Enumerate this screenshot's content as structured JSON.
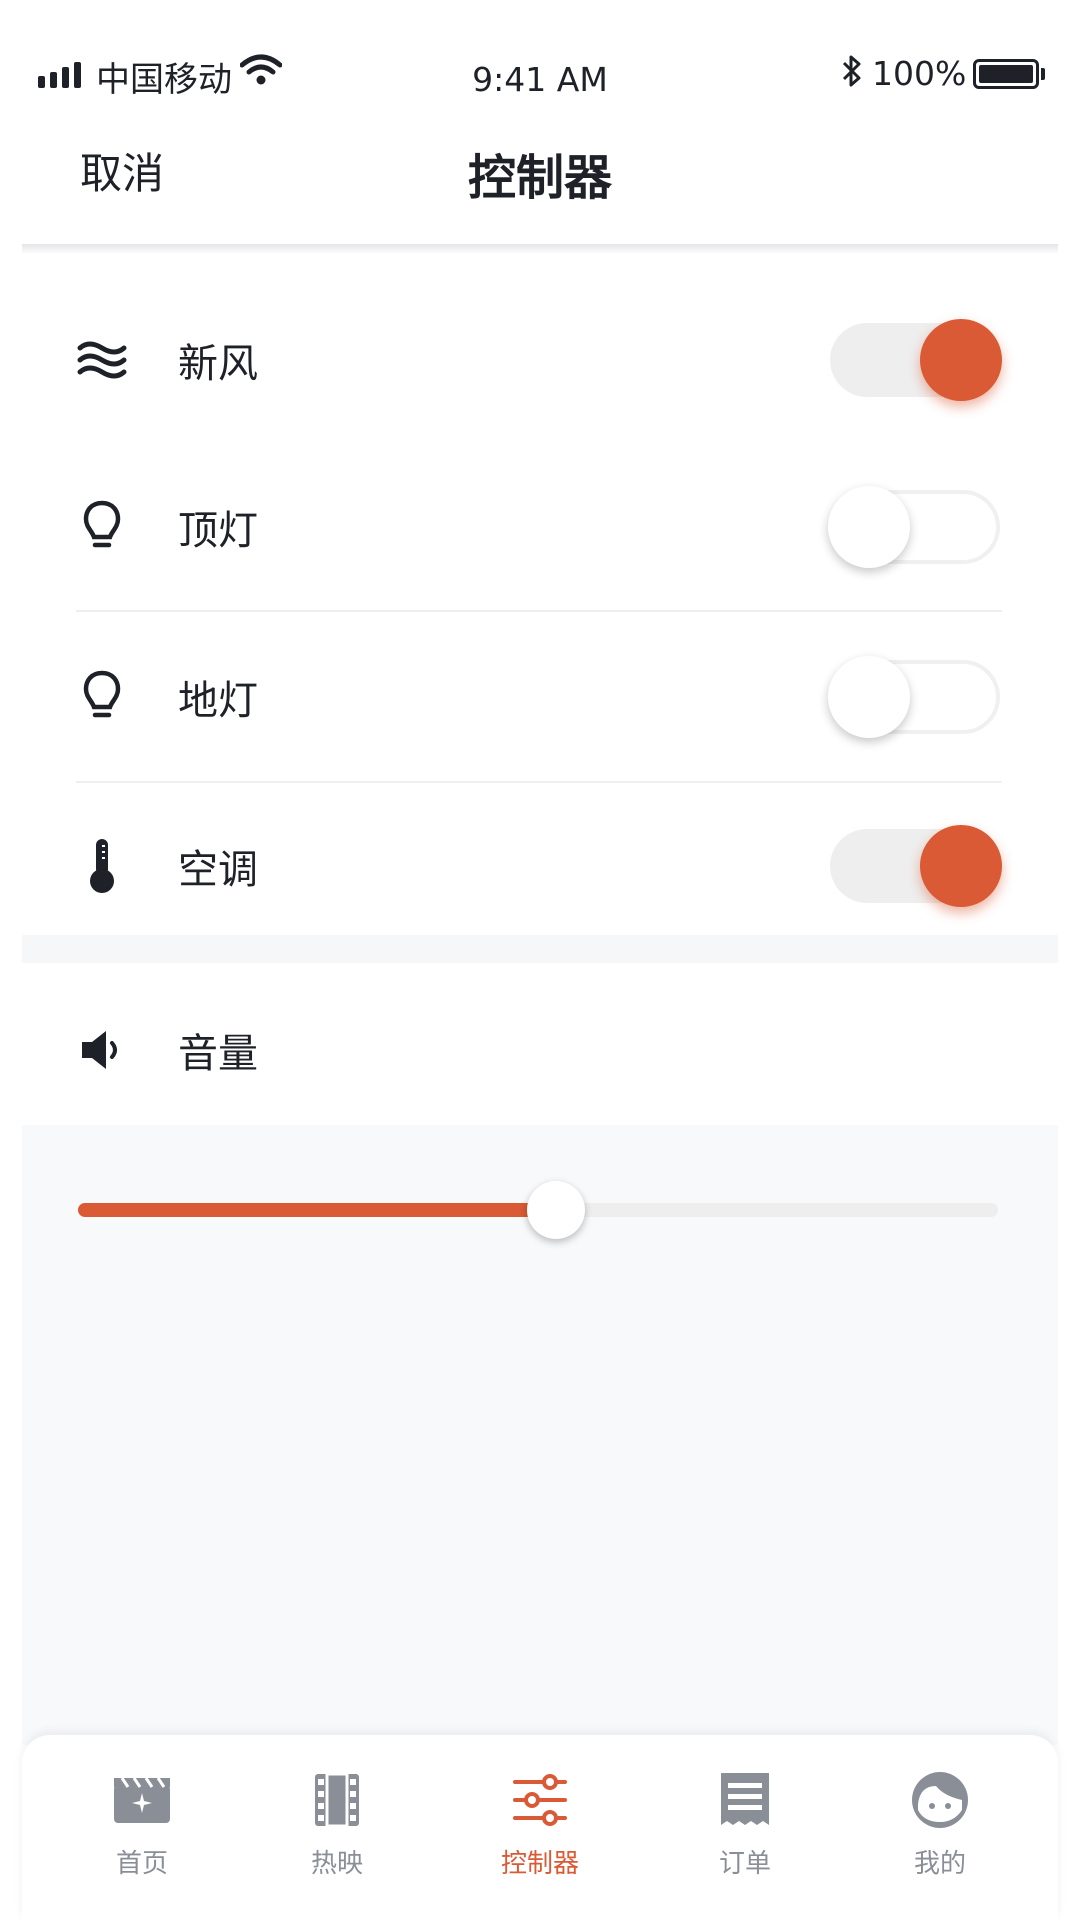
{
  "status_bar": {
    "carrier": "中国移动",
    "time": "9:41 AM",
    "battery": "100%"
  },
  "nav": {
    "cancel": "取消",
    "title": "控制器"
  },
  "controls": [
    {
      "label": "新风",
      "icon": "wind-icon",
      "on": true
    },
    {
      "label": "顶灯",
      "icon": "bulb-icon",
      "on": false
    },
    {
      "label": "地灯",
      "icon": "bulb-icon",
      "on": false
    },
    {
      "label": "空调",
      "icon": "thermometer-icon",
      "on": true
    }
  ],
  "volume": {
    "label": "音量",
    "icon": "speaker-icon",
    "value_percent": 52
  },
  "tabs": [
    {
      "label": "首页",
      "icon": "clapperboard-icon",
      "active": false
    },
    {
      "label": "热映",
      "icon": "film-icon",
      "active": false
    },
    {
      "label": "控制器",
      "icon": "sliders-icon",
      "active": true
    },
    {
      "label": "订单",
      "icon": "receipt-icon",
      "active": false
    },
    {
      "label": "我的",
      "icon": "face-icon",
      "active": false
    }
  ],
  "colors": {
    "accent": "#d95a34",
    "text": "#1e2128",
    "tab_inactive": "#8a8e97"
  }
}
